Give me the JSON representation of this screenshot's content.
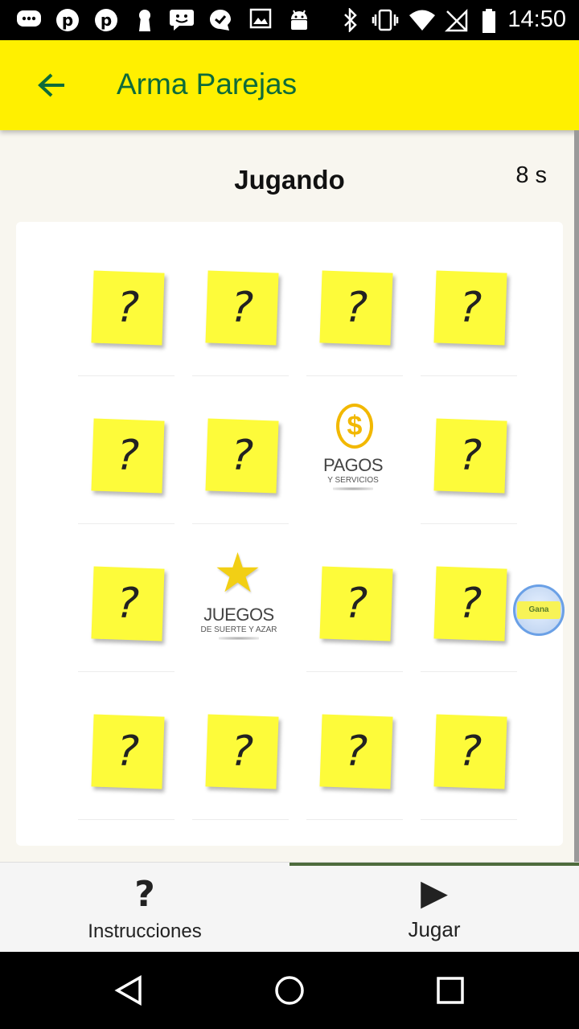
{
  "status_bar": {
    "time": "14:50",
    "icons": [
      "messages-icon",
      "pinterest-icon",
      "pinterest-icon",
      "keyhole-icon",
      "chat-icon",
      "checkmark-chat-icon",
      "image-icon",
      "android-icon",
      "bluetooth-icon",
      "vibrate-icon",
      "wifi-icon",
      "no-signal-icon",
      "battery-icon"
    ]
  },
  "app_bar": {
    "title": "Arma Parejas",
    "back_icon": "arrow-left-icon",
    "bg_color": "#fff000",
    "title_color": "#0e6b3a"
  },
  "game": {
    "status": "Jugando",
    "timer": "8 s",
    "hidden_symbol": "?",
    "cards": [
      {
        "state": "hidden"
      },
      {
        "state": "hidden"
      },
      {
        "state": "hidden"
      },
      {
        "state": "hidden"
      },
      {
        "state": "hidden"
      },
      {
        "state": "hidden"
      },
      {
        "state": "revealed",
        "logo": "pagos"
      },
      {
        "state": "hidden"
      },
      {
        "state": "hidden"
      },
      {
        "state": "revealed",
        "logo": "juegos"
      },
      {
        "state": "hidden"
      },
      {
        "state": "hidden"
      },
      {
        "state": "hidden"
      },
      {
        "state": "hidden"
      },
      {
        "state": "hidden"
      },
      {
        "state": "hidden"
      }
    ],
    "pagos_logo": {
      "coin_symbol": "$",
      "title": "PAGOS",
      "subtitle": "Y SERVICIOS"
    },
    "juegos_logo": {
      "title": "JUEGOS",
      "subtitle": "DE SUERTE Y AZAR"
    },
    "floating_bubble": {
      "label": "Gana"
    }
  },
  "bottom_nav": {
    "tabs": [
      {
        "label": "Instrucciones",
        "icon": "?",
        "active": false
      },
      {
        "label": "Jugar",
        "icon": "▶",
        "active": true
      }
    ]
  },
  "system_nav": {
    "icons": [
      "back-triangle-icon",
      "home-circle-icon",
      "recents-square-icon"
    ]
  }
}
